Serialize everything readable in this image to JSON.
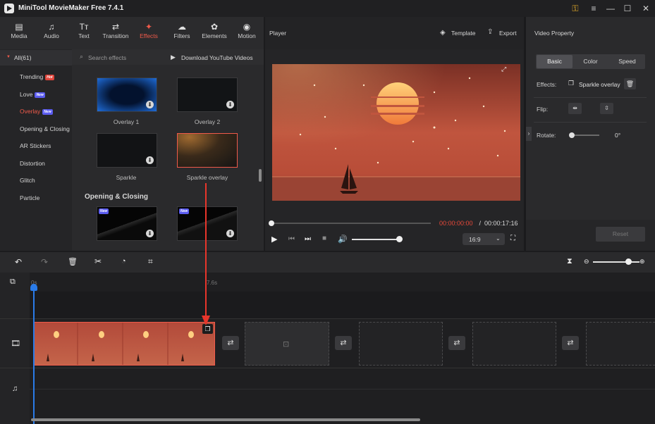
{
  "app": {
    "title": "MiniTool MovieMaker Free 7.4.1"
  },
  "toolbar": {
    "tabs": [
      {
        "label": "Media",
        "icon": "media-icon",
        "glyph": "▤"
      },
      {
        "label": "Audio",
        "icon": "music-note-icon",
        "glyph": "♫"
      },
      {
        "label": "Text",
        "icon": "text-icon",
        "glyph": "TT"
      },
      {
        "label": "Transition",
        "icon": "transition-icon",
        "glyph": "⇄"
      },
      {
        "label": "Effects",
        "icon": "effects-icon",
        "glyph": "✦",
        "active": true
      },
      {
        "label": "Filters",
        "icon": "filters-icon",
        "glyph": "☁"
      },
      {
        "label": "Elements",
        "icon": "elements-icon",
        "glyph": "✿"
      },
      {
        "label": "Motion",
        "icon": "motion-icon",
        "glyph": "◉"
      }
    ]
  },
  "sidebar": {
    "all_label": "All(61)",
    "items": [
      {
        "label": "Trending",
        "badge": "Hot"
      },
      {
        "label": "Love",
        "badge": "New"
      },
      {
        "label": "Overlay",
        "badge": "New",
        "active": true
      },
      {
        "label": "Opening & Closing"
      },
      {
        "label": "AR Stickers"
      },
      {
        "label": "Distortion"
      },
      {
        "label": "Glitch"
      },
      {
        "label": "Particle"
      }
    ]
  },
  "effects": {
    "search_placeholder": "Search effects",
    "download_label": "Download YouTube Videos",
    "thumbs": [
      {
        "caption": "Overlay 1"
      },
      {
        "caption": "Overlay 2"
      },
      {
        "caption": "Sparkle"
      },
      {
        "caption": "Sparkle overlay"
      }
    ],
    "section_title": "Opening & Closing",
    "new_badge": "New"
  },
  "player": {
    "title": "Player",
    "template_label": "Template",
    "export_label": "Export",
    "time_current": "00:00:00:00",
    "time_sep": " / ",
    "time_total": "00:00:17:16",
    "aspect": "16:9",
    "progress": 0.0,
    "volume": 1.0
  },
  "property": {
    "title": "Video Property",
    "tabs": [
      "Basic",
      "Color",
      "Speed"
    ],
    "effects_label": "Effects:",
    "effect_name": "Sparkle overlay",
    "flip_label": "Flip:",
    "rotate_label": "Rotate:",
    "rotate_value": "0°",
    "reset_label": "Reset"
  },
  "timeline": {
    "marker_start": "0s",
    "marker_mid": "7.6s",
    "zoom": 0.75
  },
  "colors": {
    "accent": "#f05a4a",
    "new_badge": "#5b5cf0",
    "hot_badge": "#e0443a",
    "arrow": "#e8352b"
  }
}
